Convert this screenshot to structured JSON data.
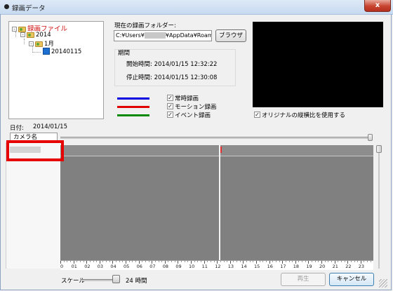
{
  "window": {
    "title": "録画データ",
    "close_glyph": "x"
  },
  "tree": {
    "root": "録画ファイル",
    "year": "2014",
    "month": "1月",
    "day": "20140115",
    "expand_glyph": "-"
  },
  "folder": {
    "label": "現在の録画フォルダー:",
    "path_prefix": "C:¥Users¥",
    "path_suffix": "¥AppData¥Roaming¥",
    "browse_label": "ブラウザ"
  },
  "period": {
    "label": "期間",
    "start": "開始時間: 2014/01/15 12:32:22",
    "stop": "停止時間: 2014/01/15 12:30:08"
  },
  "legend": [
    {
      "label": "常時録画",
      "color": "#0000e0",
      "checked": true
    },
    {
      "label": "モーション録画",
      "color": "#e00000",
      "checked": true
    },
    {
      "label": "イベント録画",
      "color": "#0a8a0a",
      "checked": true
    }
  ],
  "checkbox_glyph": "✓",
  "aspect": {
    "label": "オリジナルの縦横比を使用する",
    "checked": true
  },
  "date": {
    "label": "日付:",
    "value": "2014/01/15"
  },
  "camera_column_label": "カメラ名",
  "timeline": {
    "hours": [
      "0",
      "01",
      "02",
      "03",
      "04",
      "05",
      "06",
      "07",
      "08",
      "09",
      "10",
      "11",
      "12",
      "13",
      "14",
      "15",
      "16",
      "17",
      "18",
      "19",
      "20",
      "21",
      "22",
      "23"
    ],
    "event_color": "#e03030"
  },
  "scale": {
    "label": "スケール",
    "value": "24 時間"
  },
  "buttons": {
    "play": "再生",
    "cancel": "キャンセル"
  }
}
